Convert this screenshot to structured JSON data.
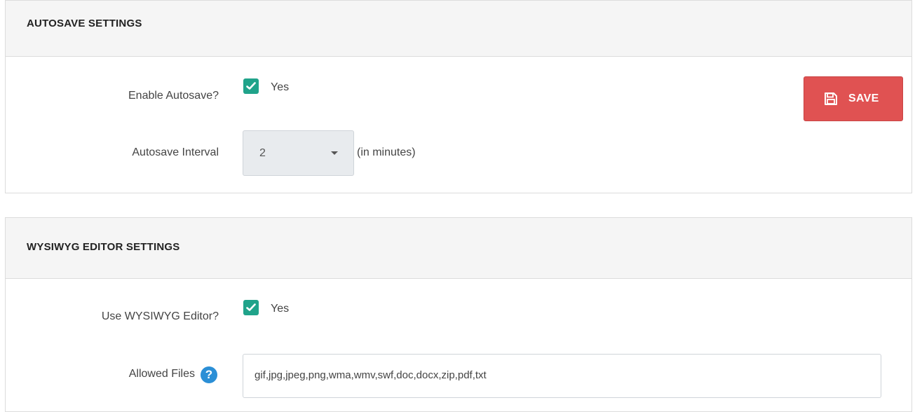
{
  "autosave": {
    "title": "AUTOSAVE SETTINGS",
    "enable_label": "Enable Autosave?",
    "enable_value": "Yes",
    "interval_label": "Autosave Interval",
    "interval_value": "2",
    "interval_hint": "(in minutes)"
  },
  "save_button": {
    "label": "SAVE",
    "icon": "floppy-disk-icon"
  },
  "wysiwyg": {
    "title": "WYSIWYG EDITOR SETTINGS",
    "use_label": "Use WYSIWYG Editor?",
    "use_value": "Yes",
    "files_label": "Allowed Files",
    "files_value": "gif,jpg,jpeg,png,wma,wmv,swf,doc,docx,zip,pdf,txt",
    "help_icon": "question-circle-icon"
  },
  "colors": {
    "checkbox": "#20a38a",
    "save_button": "#e05252",
    "help_icon": "#2b8fd6",
    "panel_header": "#f5f5f5"
  }
}
